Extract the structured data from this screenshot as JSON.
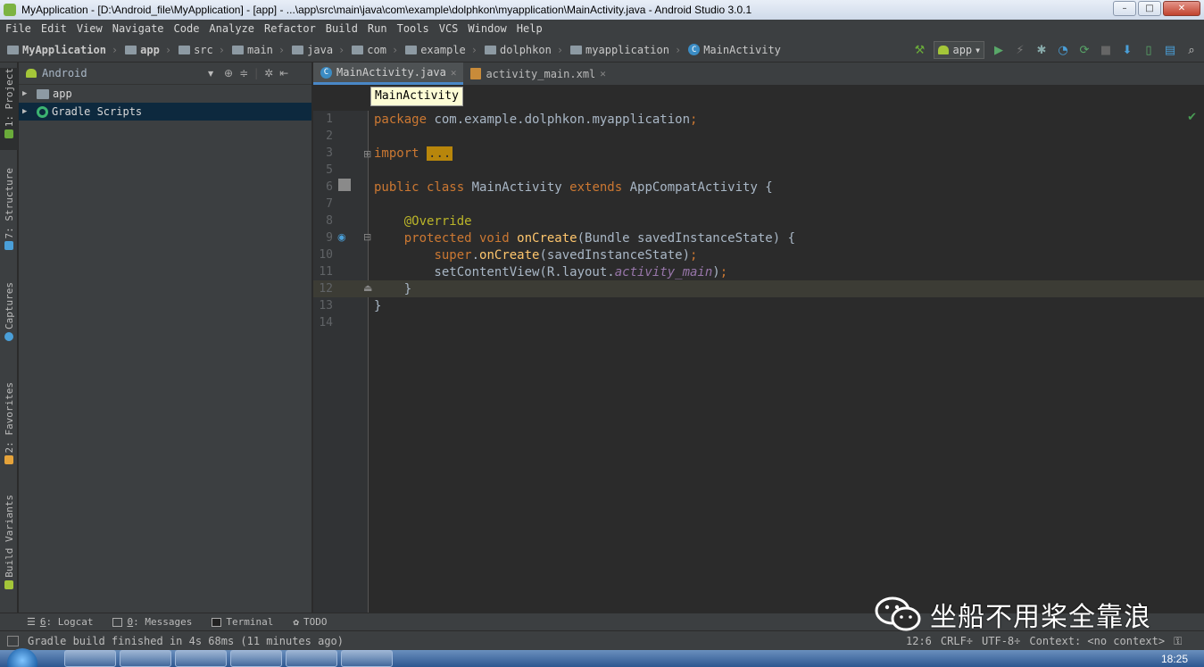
{
  "window": {
    "title": "MyApplication - [D:\\Android_file\\MyApplication] - [app] - ...\\app\\src\\main\\java\\com\\example\\dolphkon\\myapplication\\MainActivity.java - Android Studio 3.0.1",
    "min_glyph": "–",
    "max_glyph": "□",
    "close_glyph": "✕"
  },
  "menu": [
    "File",
    "Edit",
    "View",
    "Navigate",
    "Code",
    "Analyze",
    "Refactor",
    "Build",
    "Run",
    "Tools",
    "VCS",
    "Window",
    "Help"
  ],
  "breadcrumbs": [
    "MyApplication",
    "app",
    "src",
    "main",
    "java",
    "com",
    "example",
    "dolphkon",
    "myapplication",
    "MainActivity"
  ],
  "toolbar": {
    "run_config": "app",
    "icons": [
      "hammer-icon",
      "run-icon",
      "debug-icon",
      "profile-icon",
      "apply-changes-icon",
      "sync-icon",
      "stop-icon",
      "sdk-manager-icon",
      "avd-manager-icon",
      "project-structure-icon",
      "search-icon"
    ]
  },
  "left_strip": {
    "tabs": [
      "1: Project",
      "7: Structure",
      "Captures",
      "2: Favorites",
      "Build Variants"
    ]
  },
  "project": {
    "view": "Android",
    "tree": [
      {
        "label": "app",
        "expanded": false
      },
      {
        "label": "Gradle Scripts",
        "expanded": false,
        "selected": true
      }
    ]
  },
  "editor": {
    "tabs": [
      {
        "label": "MainActivity.java",
        "active": true
      },
      {
        "label": "activity_main.xml",
        "active": false
      }
    ],
    "breadcrumb_popup": "MainActivity",
    "current_line": 12,
    "lines": [
      {
        "n": "1",
        "tokens": [
          [
            "kw",
            "package "
          ],
          [
            "tx",
            "com.example.dolphkon.myapplication"
          ],
          [
            "pu",
            ";"
          ]
        ]
      },
      {
        "n": "2",
        "tokens": []
      },
      {
        "n": "3",
        "tokens": [
          [
            "kw",
            "import "
          ],
          [
            "fold",
            "..."
          ]
        ]
      },
      {
        "n": "5",
        "tokens": []
      },
      {
        "n": "6",
        "tokens": [
          [
            "kw",
            "public class "
          ],
          [
            "tx",
            "MainActivity "
          ],
          [
            "kw",
            "extends "
          ],
          [
            "tx",
            "AppCompatActivity {"
          ]
        ]
      },
      {
        "n": "7",
        "tokens": []
      },
      {
        "n": "8",
        "tokens": [
          [
            "tx",
            "    "
          ],
          [
            "an",
            "@Override"
          ]
        ]
      },
      {
        "n": "9",
        "tokens": [
          [
            "tx",
            "    "
          ],
          [
            "kw",
            "protected void "
          ],
          [
            "fn",
            "onCreate"
          ],
          [
            "tx",
            "(Bundle savedInstanceState) {"
          ]
        ]
      },
      {
        "n": "10",
        "tokens": [
          [
            "tx",
            "        "
          ],
          [
            "kw",
            "super"
          ],
          [
            "tx",
            "."
          ],
          [
            "fn",
            "onCreate"
          ],
          [
            "tx",
            "(savedInstanceState)"
          ],
          [
            "pu",
            ";"
          ]
        ]
      },
      {
        "n": "11",
        "tokens": [
          [
            "tx",
            "        setContentView(R.layout."
          ],
          [
            "mk",
            "activity_main"
          ],
          [
            "tx",
            ")"
          ],
          [
            "pu",
            ";"
          ]
        ]
      },
      {
        "n": "12",
        "tokens": [
          [
            "tx",
            "    }"
          ]
        ]
      },
      {
        "n": "13",
        "tokens": [
          [
            "tx",
            "}"
          ]
        ]
      },
      {
        "n": "14",
        "tokens": []
      }
    ]
  },
  "bottom_tabs": [
    {
      "num": "6",
      "label": ": Logcat"
    },
    {
      "num": "0",
      "label": ": Messages"
    },
    {
      "num": "",
      "label": "Terminal"
    },
    {
      "num": "",
      "label": "TODO"
    }
  ],
  "status": {
    "message": "Gradle build finished in 4s 68ms (11 minutes ago)",
    "position": "12:6",
    "line_sep": "CRLF÷",
    "encoding": "UTF-8÷",
    "context": "Context: <no context>"
  },
  "taskbar": {
    "time": "18:25"
  },
  "watermark": {
    "text": "坐船不用桨全靠浪"
  },
  "colors": {
    "accent": "#4a88c7",
    "keyword": "#cc7832",
    "function": "#ffc66d",
    "annotation": "#bbb529",
    "member": "#9876aa",
    "text": "#a9b7c6"
  }
}
